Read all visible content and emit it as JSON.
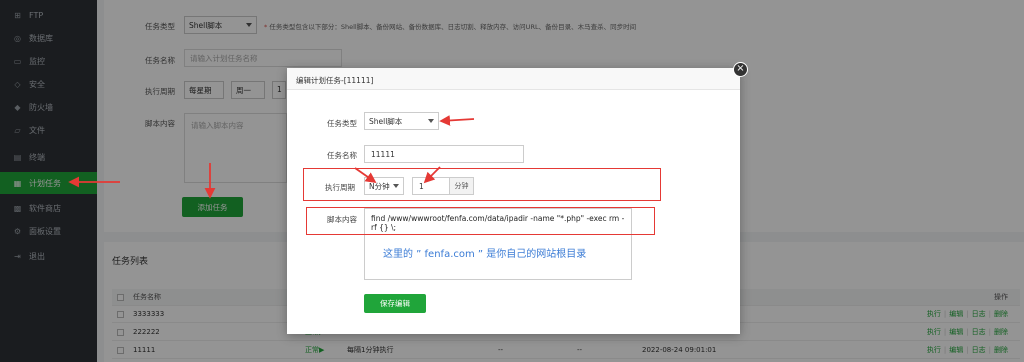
{
  "sidebar": {
    "items": [
      {
        "label": "FTP",
        "icon": "ftp-icon",
        "glyph": "⊞"
      },
      {
        "label": "数据库",
        "icon": "database-icon",
        "glyph": "◎"
      },
      {
        "label": "监控",
        "icon": "monitor-icon",
        "glyph": "▭"
      },
      {
        "label": "安全",
        "icon": "shield-icon",
        "glyph": "◇"
      },
      {
        "label": "防火墙",
        "icon": "firewall-icon",
        "glyph": "◆"
      },
      {
        "label": "文件",
        "icon": "folder-icon",
        "glyph": "▱"
      },
      {
        "label": "终端",
        "icon": "terminal-icon",
        "glyph": "▤"
      },
      {
        "label": "计划任务",
        "icon": "calendar-icon",
        "glyph": "▦"
      },
      {
        "label": "软件商店",
        "icon": "store-icon",
        "glyph": "▩"
      },
      {
        "label": "面板设置",
        "icon": "settings-icon",
        "glyph": "⚙"
      },
      {
        "label": "退出",
        "icon": "logout-icon",
        "glyph": "⇥"
      }
    ],
    "active_index": 7
  },
  "background_form": {
    "type_label": "任务类型",
    "type_value": "Shell脚本",
    "type_hint_star": "*",
    "type_hint": "任务类型包含以下部分：Shell脚本、备份网站、备份数据库、日志切割、释放内存、访问URL、备份目录、木马查杀、同步时间",
    "name_label": "任务名称",
    "name_placeholder": "请输入计划任务名称",
    "period_label": "执行周期",
    "period_unit": "每星期",
    "period_day": "周一",
    "period_hour": "1",
    "script_label": "脚本内容",
    "script_placeholder": "请输入脚本内容",
    "add_button": "添加任务"
  },
  "task_list": {
    "title": "任务列表",
    "header": {
      "name": "任务名称",
      "ops": "操作"
    },
    "rows": [
      {
        "name": "3333333",
        "status": "",
        "period": "",
        "a": "",
        "b": "",
        "time": ""
      },
      {
        "name": "222222",
        "status": "正常▶",
        "period": "",
        "a": "",
        "b": "",
        "time": ""
      },
      {
        "name": "11111",
        "status": "正常▶",
        "period": "每隔1分钟执行",
        "a": "--",
        "b": "--",
        "time": "2022-08-24 09:01:01"
      }
    ],
    "ops": [
      "执行",
      "编辑",
      "日志",
      "删除"
    ]
  },
  "modal": {
    "title": "编辑计划任务-[11111]",
    "type_label": "任务类型",
    "type_value": "Shell脚本",
    "name_label": "任务名称",
    "name_value": "11111",
    "period_label": "执行周期",
    "period_unit": "N分钟",
    "period_value": "1",
    "period_suffix": "分钟",
    "script_label": "脚本内容",
    "script_value": "find /www/wwwroot/fenfa.com/data/ipadir -name \"*.php\" -exec rm -rf {} \\;",
    "annotation": "这里的 ” fenfa.com ” 是你自己的网站根目录",
    "save_button": "保存编辑"
  },
  "colors": {
    "accent": "#20a53a",
    "annotation": "#e53935",
    "note": "#3a7bd5",
    "sidebar": "#2d3136"
  }
}
